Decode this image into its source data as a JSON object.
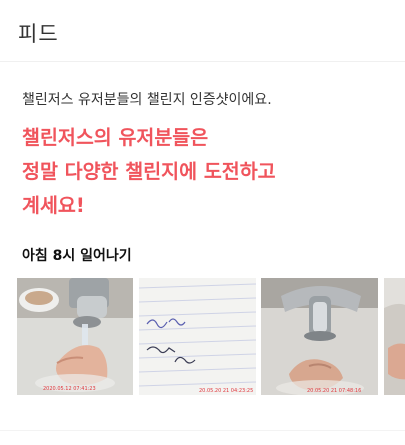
{
  "header": {
    "title": "피드"
  },
  "intro": {
    "text": "챌린저스 유저분들의 챌린지 인증샷이에요."
  },
  "headline": {
    "lines": [
      "챌린저스의 유저분들은",
      "정말 다양한 챌린지에 도전하고",
      "계세요!"
    ]
  },
  "challenge": {
    "title": "아침 8시 일어나기"
  },
  "photos": [
    {
      "subject": "hand under faucet",
      "timestamp": "2020.05.12 07:41:23"
    },
    {
      "subject": "handwritten notebook page",
      "timestamp": "20.05.20 21 04:23:25"
    },
    {
      "subject": "hand under faucet",
      "timestamp": "20.05.20 21 07:48:16"
    },
    {
      "subject": "partial photo",
      "timestamp": ""
    }
  ],
  "colors": {
    "accent": "#f0545c",
    "stamp": "#e0393f"
  }
}
